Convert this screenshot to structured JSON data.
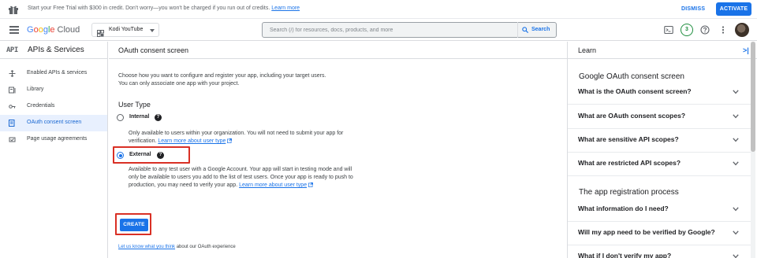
{
  "banner": {
    "message": "Start your Free Trial with $300 in credit. Don't worry—you won't be charged if you run out of credits.",
    "link": "Learn more",
    "dismiss": "DISMISS",
    "activate": "ACTIVATE"
  },
  "header": {
    "logo_google": [
      "G",
      "o",
      "o",
      "g",
      "l",
      "e"
    ],
    "logo_cloud": "Cloud",
    "project": "Kodi YouTube",
    "search_placeholder": "Search (/) for resources, docs, products, and more",
    "search_button": "Search",
    "notification_count": "3"
  },
  "sidebar": {
    "logo": "API",
    "title": "APIs & Services",
    "items": [
      {
        "label": "Enabled APIs & services",
        "icon": "apis-icon"
      },
      {
        "label": "Library",
        "icon": "library-icon"
      },
      {
        "label": "Credentials",
        "icon": "key-icon"
      },
      {
        "label": "OAuth consent screen",
        "icon": "consent-icon",
        "active": true
      },
      {
        "label": "Page usage agreements",
        "icon": "agreements-icon"
      }
    ]
  },
  "main": {
    "title": "OAuth consent screen",
    "intro": "Choose how you want to configure and register your app, including your target users. You can only associate one app with your project.",
    "user_type_heading": "User Type",
    "internal": {
      "label": "Internal",
      "desc": "Only available to users within your organization. You will not need to submit your app for verification.",
      "link": "Learn more about user type"
    },
    "external": {
      "label": "External",
      "desc": "Available to any test user with a Google Account. Your app will start in testing mode and will only be available to users you add to the list of test users. Once your app is ready to push to production, you may need to verify your app.",
      "link": "Learn more about user type"
    },
    "create_button": "CREATE",
    "feedback_link": "Let us know what you think",
    "feedback_rest": " about our OAuth experience"
  },
  "learn": {
    "title": "Learn",
    "section1": "Google OAuth consent screen",
    "questions1": [
      "What is the OAuth consent screen?",
      "What are OAuth consent scopes?",
      "What are sensitive API scopes?",
      "What are restricted API scopes?"
    ],
    "section2": "The app registration process",
    "questions2": [
      "What information do I need?",
      "Will my app need to be verified by Google?",
      "What if I don't verify my app?"
    ]
  },
  "colors": {
    "accent": "#1a73e8",
    "highlight": "#d93025",
    "active_nav_bg": "#e8f0fe"
  }
}
